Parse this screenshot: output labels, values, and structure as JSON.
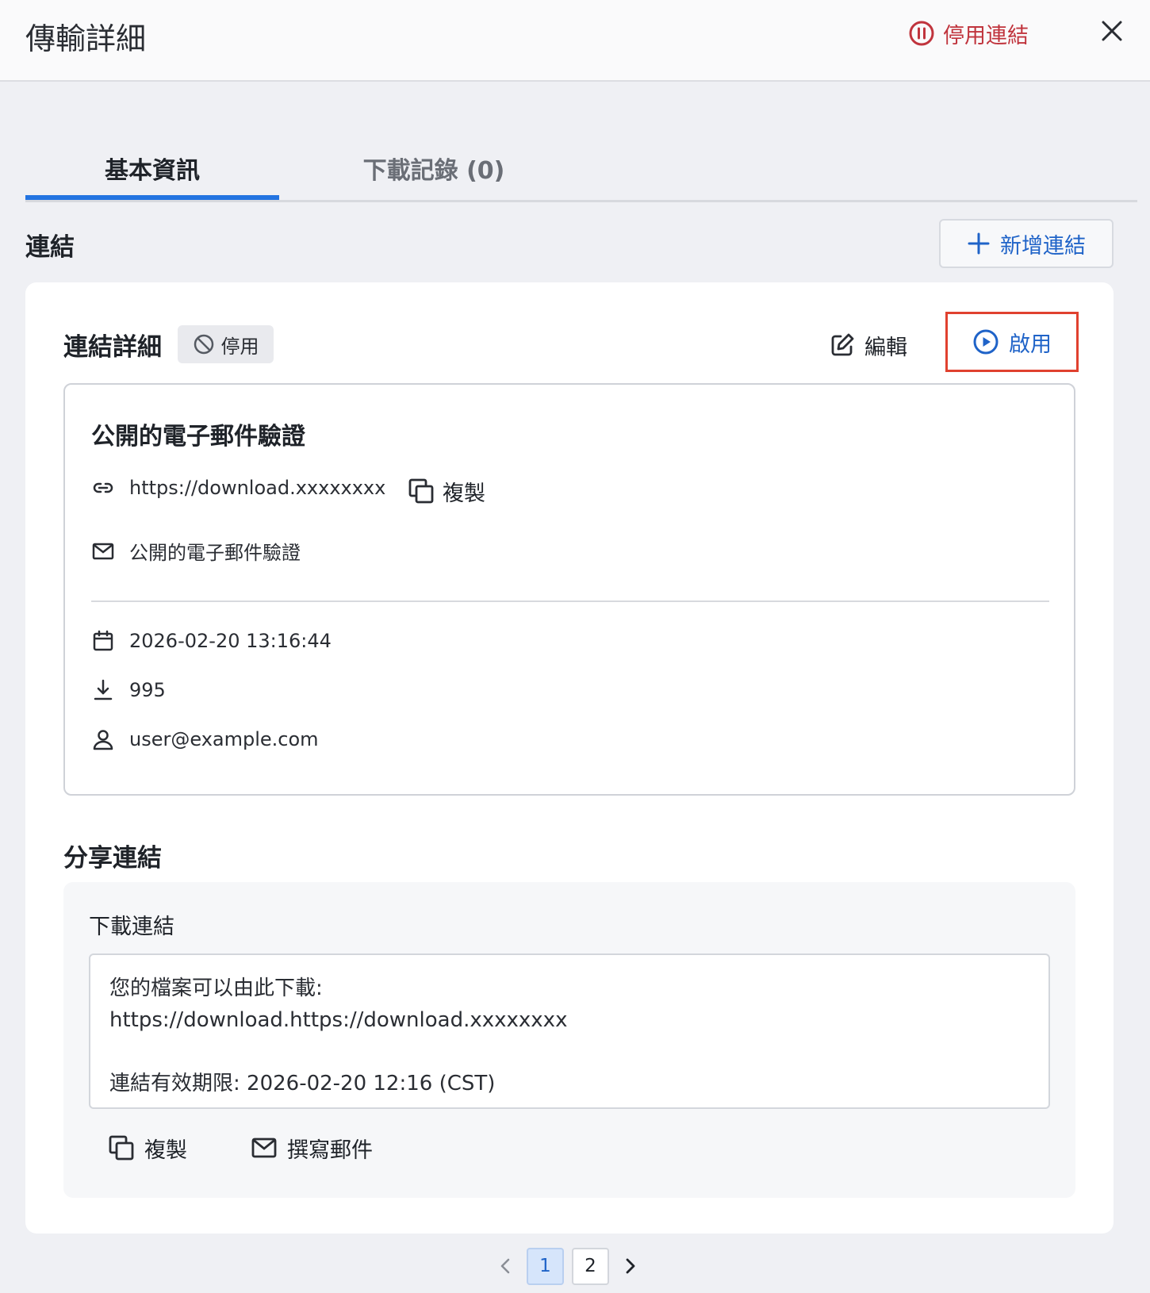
{
  "header": {
    "title": "傳輸詳細",
    "disable_link_label": "停用連結",
    "colors": {
      "danger": "#c0343d",
      "accent": "#1f63c8"
    }
  },
  "tabs": [
    {
      "label": "基本資訊",
      "active": true
    },
    {
      "label": "下載記錄 (0)",
      "active": false
    }
  ],
  "links_section": {
    "title": "連結",
    "add_link_label": "新增連結"
  },
  "link_detail": {
    "title": "連結詳細",
    "status_badge": "停用",
    "edit_label": "編輯",
    "enable_label": "啟用",
    "name": "公開的電子郵件驗證",
    "url": "https://download.xxxxxxxx",
    "copy_label": "複製",
    "verification": "公開的電子郵件驗證",
    "created_at": "2026-02-20 13:16:44",
    "download_count": "995",
    "owner": "user@example.com"
  },
  "share": {
    "title": "分享連結",
    "download_link_label": "下載連結",
    "message_line1": "您的檔案可以由此下載:",
    "message_line2": "https://download.https://download.xxxxxxxx",
    "message_line3": "連結有效期限: 2026-02-20 12:16 (CST)",
    "copy_label": "複製",
    "compose_label": "撰寫郵件"
  },
  "pagination": {
    "pages": [
      "1",
      "2"
    ],
    "current": "1"
  }
}
